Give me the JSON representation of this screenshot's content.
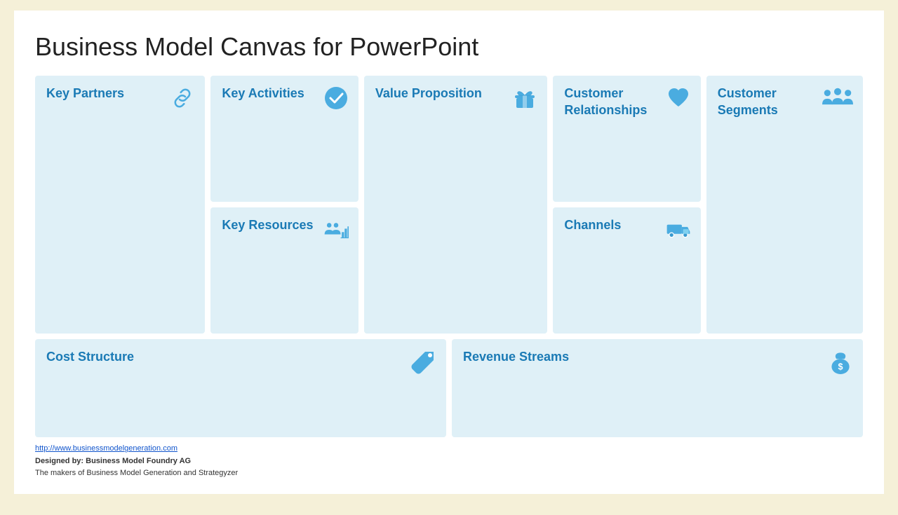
{
  "title": "Business Model Canvas for PowerPoint",
  "cells": {
    "keyPartners": {
      "label": "Key Partners",
      "icon": "link"
    },
    "keyActivities": {
      "label": "Key Activities",
      "icon": "checkmark"
    },
    "keyResources": {
      "label": "Key Resources",
      "icon": "people-bar"
    },
    "valueProposition": {
      "label": "Value Proposition",
      "icon": "gift"
    },
    "customerRelationships": {
      "label": "Customer Relationships",
      "icon": "heart"
    },
    "channels": {
      "label": "Channels",
      "icon": "truck"
    },
    "customerSegments": {
      "label": "Customer Segments",
      "icon": "people"
    },
    "costStructure": {
      "label": "Cost Structure",
      "icon": "tag"
    },
    "revenueStreams": {
      "label": "Revenue Streams",
      "icon": "money"
    }
  },
  "footer": {
    "url": "http://www.businessmodelgeneration.com",
    "designedBy": "Designed by: Business Model Foundry AG",
    "tagline": "The makers of Business Model Generation and Strategyzer"
  },
  "colors": {
    "accent": "#4aace0",
    "cellBg": "#dff0f7",
    "titleText": "#1a7ab5"
  }
}
